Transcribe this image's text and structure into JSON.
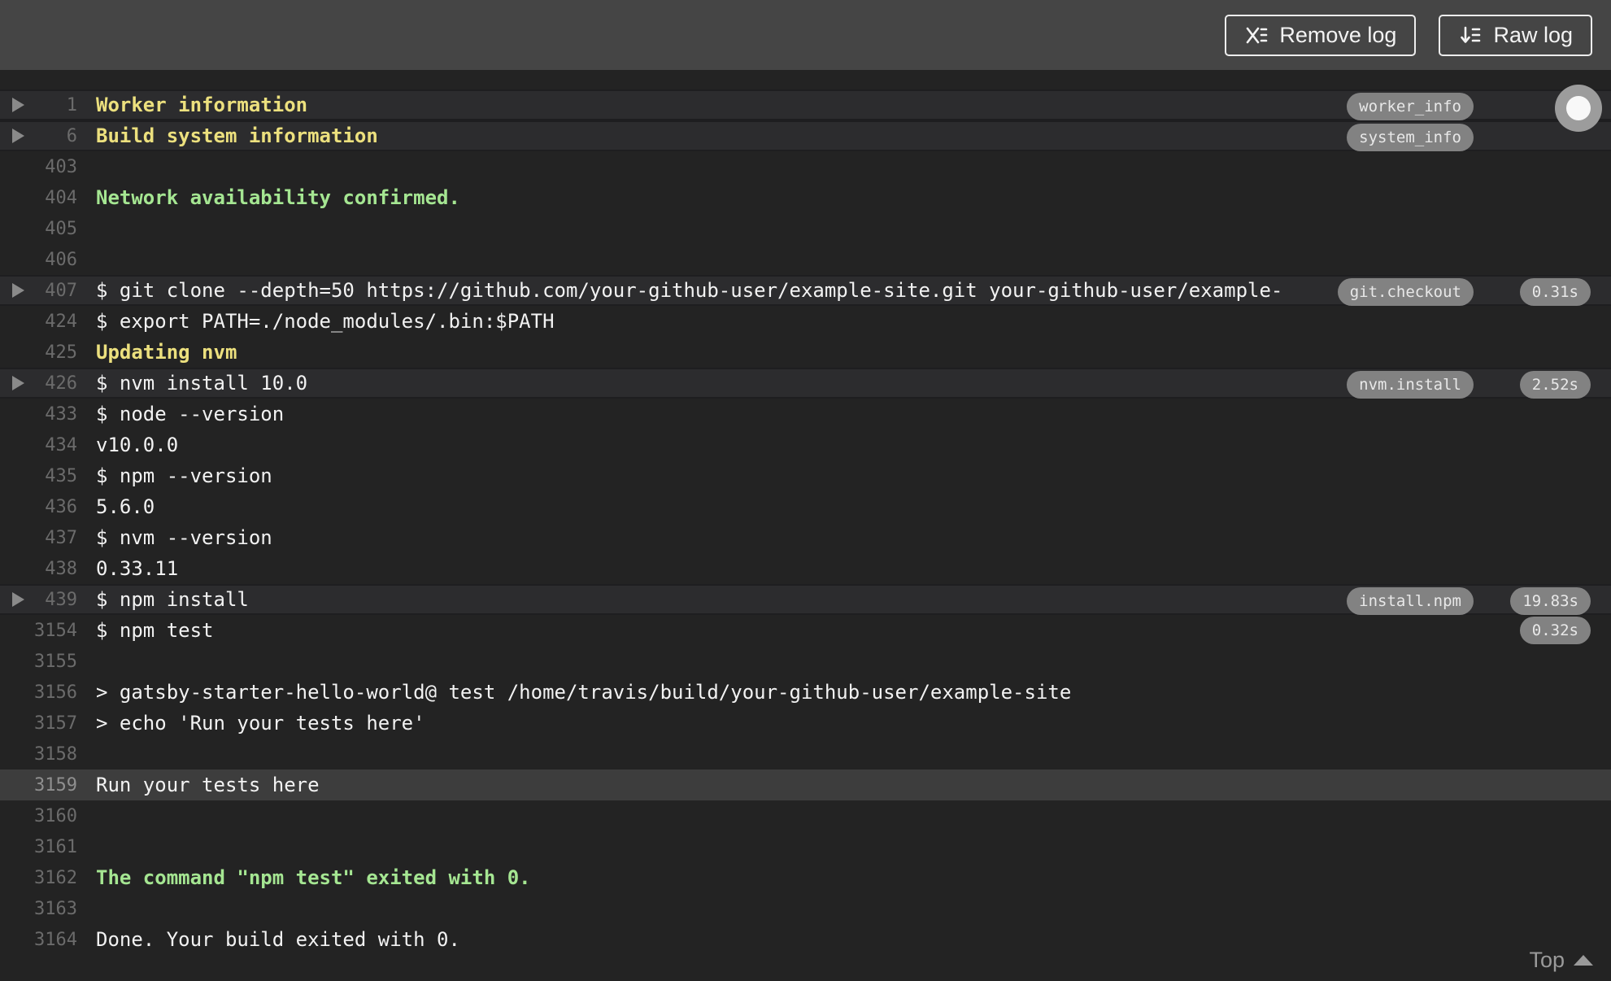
{
  "toolbar": {
    "remove_log_label": "Remove log",
    "raw_log_label": "Raw log"
  },
  "log": {
    "colors": {
      "page_background": "#232323",
      "topbar_background": "#454545",
      "fold_row_background": "#2c2c2e",
      "highlight_row_background": "#3d3d3d",
      "text": "#f2f2f2",
      "yellow_text": "#ece07e",
      "green_text": "#a5e692",
      "line_number": "#6b6b6b",
      "badge_background": "#828282"
    },
    "lines": [
      {
        "n": "1",
        "t": "Worker information",
        "color": "yellow",
        "row": "header",
        "fold": true,
        "tag": "worker_info"
      },
      {
        "n": "6",
        "t": "Build system information",
        "color": "yellow",
        "row": "header",
        "fold": true,
        "tag": "system_info"
      },
      {
        "n": "403",
        "t": ""
      },
      {
        "n": "404",
        "t": "Network availability confirmed.",
        "color": "green"
      },
      {
        "n": "405",
        "t": ""
      },
      {
        "n": "406",
        "t": ""
      },
      {
        "n": "407",
        "t": "$ git clone --depth=50 https://github.com/your-github-user/example-site.git your-github-user/example-",
        "row": "header",
        "fold": true,
        "tag": "git.checkout",
        "duration": "0.31s"
      },
      {
        "n": "424",
        "t": "$ export PATH=./node_modules/.bin:$PATH"
      },
      {
        "n": "425",
        "t": "Updating nvm",
        "color": "yellow"
      },
      {
        "n": "426",
        "t": "$ nvm install 10.0",
        "row": "header",
        "fold": true,
        "tag": "nvm.install",
        "duration": "2.52s"
      },
      {
        "n": "433",
        "t": "$ node --version"
      },
      {
        "n": "434",
        "t": "v10.0.0"
      },
      {
        "n": "435",
        "t": "$ npm --version"
      },
      {
        "n": "436",
        "t": "5.6.0"
      },
      {
        "n": "437",
        "t": "$ nvm --version"
      },
      {
        "n": "438",
        "t": "0.33.11"
      },
      {
        "n": "439",
        "t": "$ npm install",
        "row": "header",
        "fold": true,
        "tag": "install.npm",
        "duration": "19.83s"
      },
      {
        "n": "3154",
        "t": "$ npm test",
        "duration": "0.32s"
      },
      {
        "n": "3155",
        "t": ""
      },
      {
        "n": "3156",
        "t": "> gatsby-starter-hello-world@ test /home/travis/build/your-github-user/example-site"
      },
      {
        "n": "3157",
        "t": "> echo 'Run your tests here'"
      },
      {
        "n": "3158",
        "t": ""
      },
      {
        "n": "3159",
        "t": "Run your tests here",
        "row": "highlight"
      },
      {
        "n": "3160",
        "t": ""
      },
      {
        "n": "3161",
        "t": ""
      },
      {
        "n": "3162",
        "t": "The command \"npm test\" exited with 0.",
        "color": "green"
      },
      {
        "n": "3163",
        "t": ""
      },
      {
        "n": "3164",
        "t": "Done. Your build exited with 0."
      }
    ]
  },
  "footer": {
    "top_label": "Top"
  }
}
